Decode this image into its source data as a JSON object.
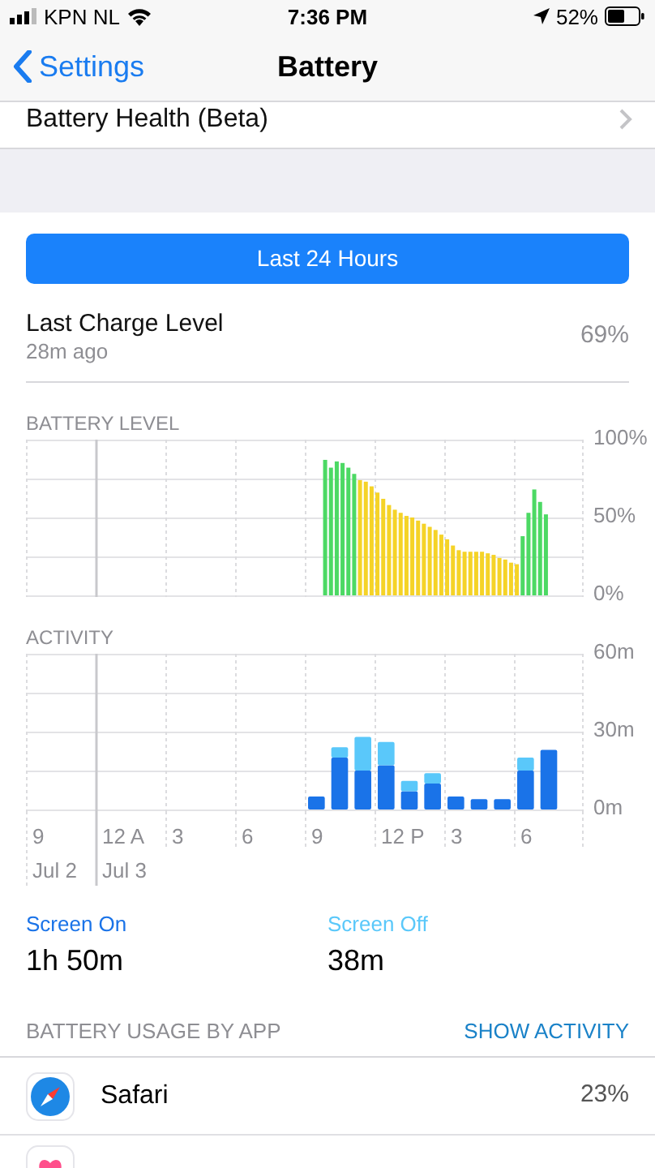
{
  "status_bar": {
    "carrier": "KPN NL",
    "time": "7:36 PM",
    "battery": "52%"
  },
  "nav": {
    "back": "Settings",
    "title": "Battery"
  },
  "health_row": {
    "label": "Battery Health (Beta)"
  },
  "range_button": {
    "label": "Last 24 Hours",
    "selected": true
  },
  "last_charge": {
    "label": "Last Charge Level",
    "sub": "28m ago",
    "value": "69%"
  },
  "battery_level": {
    "title": "BATTERY LEVEL",
    "chart_data": {
      "type": "bar",
      "stacked": true,
      "ylim": [
        0,
        100
      ],
      "yticks": [
        {
          "value": 0,
          "label": "0%"
        },
        {
          "value": 50,
          "label": "50%"
        },
        {
          "value": 100,
          "label": "100%"
        }
      ],
      "series": [
        {
          "color": "#4cd964",
          "values": [
            null,
            null,
            null,
            null,
            null,
            null,
            null,
            null,
            null,
            null,
            null,
            null,
            null,
            null,
            null,
            null,
            null,
            null,
            null,
            null,
            null,
            null,
            null,
            null,
            null,
            null,
            null,
            null,
            null,
            null,
            null,
            null,
            null,
            null,
            null,
            null,
            null,
            null,
            null,
            null,
            null,
            null,
            null,
            null,
            null,
            null,
            null,
            null,
            null,
            null,
            null,
            87,
            82,
            86,
            85,
            82,
            78,
            null,
            null,
            null,
            null,
            null,
            null,
            null,
            null,
            null,
            null,
            null,
            null,
            null,
            null,
            null,
            null,
            null,
            null,
            null,
            null,
            null,
            null,
            null,
            null,
            null,
            null,
            null,
            null,
            38,
            53,
            68,
            60,
            52,
            null,
            null,
            null,
            null,
            null,
            null
          ]
        },
        {
          "color": "#f5d327",
          "values": [
            null,
            null,
            null,
            null,
            null,
            null,
            null,
            null,
            null,
            null,
            null,
            null,
            null,
            null,
            null,
            null,
            null,
            null,
            null,
            null,
            null,
            null,
            null,
            null,
            null,
            null,
            null,
            null,
            null,
            null,
            null,
            null,
            null,
            null,
            null,
            null,
            null,
            null,
            null,
            null,
            null,
            null,
            null,
            null,
            null,
            null,
            null,
            null,
            null,
            null,
            null,
            null,
            null,
            null,
            null,
            null,
            null,
            74,
            73,
            70,
            66,
            62,
            58,
            55,
            53,
            51,
            50,
            48,
            46,
            44,
            42,
            39,
            36,
            32,
            29,
            28,
            28,
            28,
            28,
            27,
            26,
            24,
            23,
            21,
            20,
            null,
            null,
            null,
            null,
            null,
            null,
            null,
            null,
            null,
            null,
            null
          ]
        }
      ]
    }
  },
  "activity": {
    "title": "ACTIVITY",
    "chart_data": {
      "type": "bar",
      "stacked": true,
      "ylim": [
        0,
        60
      ],
      "yticks": [
        {
          "value": 0,
          "label": "0m"
        },
        {
          "value": 30,
          "label": "30m"
        },
        {
          "value": 60,
          "label": "60m"
        }
      ],
      "series": [
        {
          "color": "#1a73e8",
          "values": [
            null,
            null,
            null,
            null,
            null,
            null,
            null,
            null,
            null,
            null,
            null,
            null,
            5,
            20,
            15,
            17,
            7,
            10,
            5,
            4,
            4,
            15,
            23,
            null
          ]
        },
        {
          "color": "#5ac8fa",
          "values": [
            null,
            null,
            null,
            null,
            null,
            null,
            null,
            null,
            null,
            null,
            null,
            null,
            null,
            4,
            13,
            9,
            4,
            4,
            null,
            null,
            null,
            5,
            null,
            null
          ]
        }
      ]
    },
    "time_labels": [
      "9",
      "12 A",
      "3",
      "6",
      "9",
      "12 P",
      "3",
      "6"
    ],
    "date_labels": [
      "Jul 2",
      "Jul 3"
    ]
  },
  "summary": [
    {
      "label": "Screen On",
      "value": "1h 50m"
    },
    {
      "label": "Screen Off",
      "value": "38m"
    }
  ],
  "usage_header": {
    "title": "BATTERY USAGE BY APP",
    "action": "SHOW ACTIVITY"
  },
  "apps": [
    {
      "kind": "safari",
      "name": "Safari",
      "percent": "23%"
    },
    {
      "kind": "health"
    }
  ]
}
